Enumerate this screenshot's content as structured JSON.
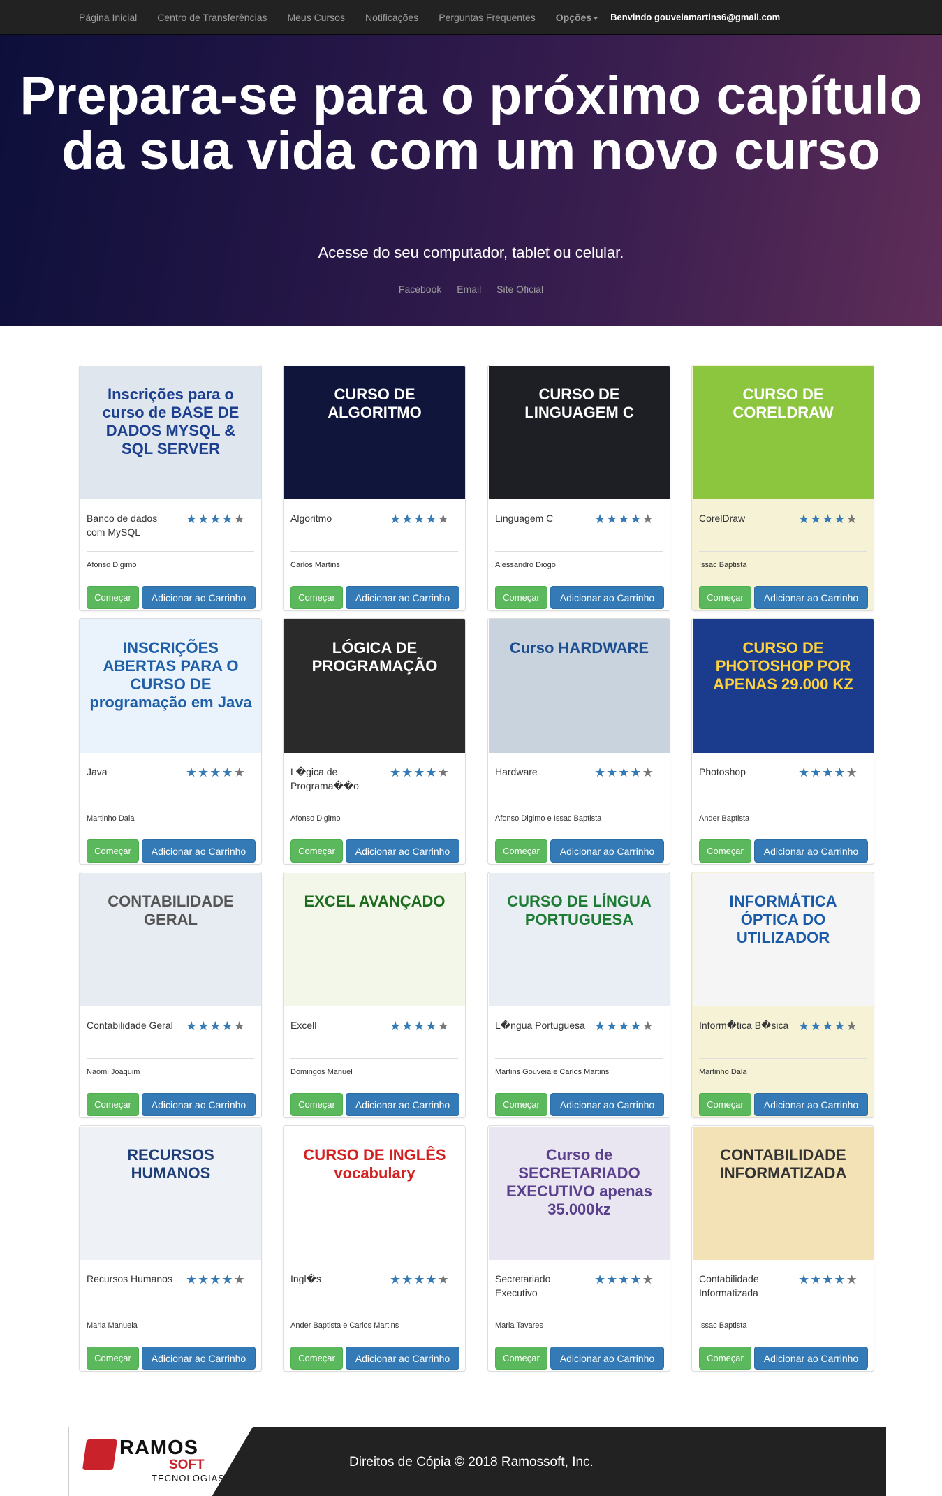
{
  "nav": {
    "items": [
      "Página Inicial",
      "Centro de Transferências",
      "Meus Cursos",
      "Notificações",
      "Perguntas Frequentes"
    ],
    "options_label": "Opções",
    "welcome": "Benvindo gouveiamartins6@gmail.com"
  },
  "hero": {
    "title": "Prepara-se para o próximo capítulo da sua vida com um novo curso",
    "subtitle": "Acesse do seu computador, tablet ou celular.",
    "links": [
      "Facebook",
      "Email",
      "Site Oficial"
    ]
  },
  "buttons": {
    "start": "Começar",
    "cart": "Adicionar ao Carrinho"
  },
  "courses": [
    {
      "title": "Banco de dados com MySQL",
      "author": "Afonso Digimo",
      "rating": 4,
      "thumb": "Inscrições para o curso de BASE DE DADOS MYSQL & SQL SERVER",
      "bg": "#dfe6ee",
      "fg": "#1c3f8f"
    },
    {
      "title": "Algoritmo",
      "author": "Carlos Martins",
      "rating": 4,
      "thumb": "CURSO DE ALGORITMO",
      "bg": "#10163b",
      "fg": "#ffffff"
    },
    {
      "title": "Linguagem C",
      "author": "Alessandro Diogo",
      "rating": 4,
      "thumb": "CURSO DE LINGUAGEM C",
      "bg": "#1d1f24",
      "fg": "#ffffff"
    },
    {
      "title": "CorelDraw",
      "author": "Issac Baptista",
      "rating": 4,
      "thumb": "CURSO DE CORELDRAW",
      "bg": "#8cc63f",
      "fg": "#ffffff",
      "highlight": true
    },
    {
      "title": "Java",
      "author": "Martinho Dala",
      "rating": 4,
      "thumb": "INSCRIÇÕES ABERTAS PARA O CURSO DE programação em Java",
      "bg": "#eaf3fb",
      "fg": "#1f5fa8"
    },
    {
      "title": "L�gica de Programa��o",
      "author": "Afonso Digimo",
      "rating": 4,
      "thumb": "LÓGICA DE PROGRAMAÇÃO",
      "bg": "#2a2a2a",
      "fg": "#ffffff"
    },
    {
      "title": "Hardware",
      "author": "Afonso Digimo e Issac Baptista",
      "rating": 4,
      "thumb": "Curso HARDWARE",
      "bg": "#c9d3dd",
      "fg": "#1d4e8f"
    },
    {
      "title": "Photoshop",
      "author": "Ander Baptista",
      "rating": 4,
      "thumb": "CURSO DE PHOTOSHOP POR APENAS 29.000 KZ",
      "bg": "#1b3c8c",
      "fg": "#ffd23c"
    },
    {
      "title": "Contabilidade Geral",
      "author": "Naomi Joaquim",
      "rating": 4,
      "thumb": "CONTABILIDADE GERAL",
      "bg": "#e6ecf2",
      "fg": "#555555"
    },
    {
      "title": "Excell",
      "author": "Domingos Manuel",
      "rating": 4,
      "thumb": "EXCEL AVANÇADO",
      "bg": "#f2f7ea",
      "fg": "#1e6d1e"
    },
    {
      "title": "L�ngua Portuguesa",
      "author": "Martins Gouveia e Carlos Martins",
      "rating": 4,
      "thumb": "CURSO DE LÍNGUA PORTUGUESA",
      "bg": "#e8eef4",
      "fg": "#1e7b34"
    },
    {
      "title": "Inform�tica B�sica",
      "author": "Martinho Dala",
      "rating": 4,
      "thumb": "INFORMÁTICA ÓPTICA DO UTILIZADOR",
      "bg": "#f5f5f5",
      "fg": "#1a5aa8",
      "highlight": true
    },
    {
      "title": "Recursos Humanos",
      "author": "Maria Manuela",
      "rating": 4,
      "thumb": "RECURSOS HUMANOS",
      "bg": "#eef2f6",
      "fg": "#1f3f78"
    },
    {
      "title": "Ingl�s",
      "author": "Ander Baptista e Carlos Martins",
      "rating": 4,
      "thumb": "CURSO DE INGLÊS vocabulary",
      "bg": "#ffffff",
      "fg": "#d32020"
    },
    {
      "title": "Secretariado Executivo",
      "author": "Maria Tavares",
      "rating": 4,
      "thumb": "Curso de SECRETARIADO EXECUTIVO apenas 35.000kz",
      "bg": "#e9e6f1",
      "fg": "#5a3f8d"
    },
    {
      "title": "Contabilidade Informatizada",
      "author": "Issac Baptista",
      "rating": 4,
      "thumb": "CONTABILIDADE INFORMATIZADA",
      "bg": "#f3e2b5",
      "fg": "#333333"
    }
  ],
  "footer": {
    "brand_line1": "RAMOS",
    "brand_line2": "SOFT",
    "brand_line3": "TECNOLOGIAS",
    "copyright": "Direitos de Cópia © 2018 Ramossoft, Inc."
  }
}
